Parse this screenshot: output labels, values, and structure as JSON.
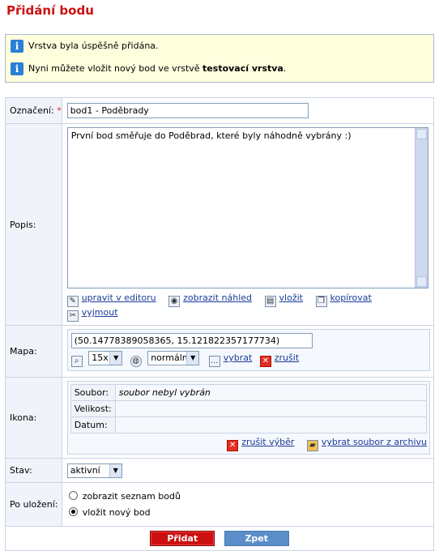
{
  "page": {
    "title": "Přidání bodu"
  },
  "messages": {
    "msg1": "Vrstva byla úspěšně přidána.",
    "msg2_prefix": "Nyni můžete vložit nový bod ve vrstvě ",
    "msg2_layer": "testovací vrstva",
    "msg2_suffix": "."
  },
  "form": {
    "oznaceni": {
      "label": "Označení:",
      "required_mark": "*",
      "value": "bod1 - Poděbrady"
    },
    "popis": {
      "label": "Popis:",
      "value": "První bod směřuje do Poděbrad, které byly náhodně vybrány :)",
      "tools": {
        "edit": "upravit v editoru",
        "preview": "zobrazit náhled",
        "paste": "vložit",
        "copy": "kopírovat",
        "cut": "vyjmout"
      }
    },
    "mapa": {
      "label": "Mapa:",
      "coords": "(50.14778389058365, 15.121822357177734)",
      "zoom": "15x",
      "map_type": "normální",
      "choose_dots": "...",
      "choose": "vybrat",
      "cancel": "zrušit"
    },
    "ikona": {
      "label": "Ikona:",
      "soubor_key": "Soubor:",
      "soubor_val": "soubor nebyl vybrán",
      "velikost_key": "Velikost:",
      "velikost_val": "",
      "datum_key": "Datum:",
      "datum_val": "",
      "cancel_selection": "zrušit výběr",
      "choose_from_archive": "vybrat soubor z archivu"
    },
    "stav": {
      "label": "Stav:",
      "value": "aktivní"
    },
    "po_ulozeni": {
      "label": "Po uložení:",
      "option1": "zobrazit seznam bodů",
      "option2": "vložit nový bod",
      "selected": "option2"
    }
  },
  "buttons": {
    "add": "Přidat",
    "back": "Zpet"
  },
  "colors": {
    "title_red": "#cc1111",
    "info_blue": "#2a7fd6",
    "message_bg": "#ffffdd",
    "add_button": "#cc1010",
    "back_button": "#5b8ec9"
  }
}
